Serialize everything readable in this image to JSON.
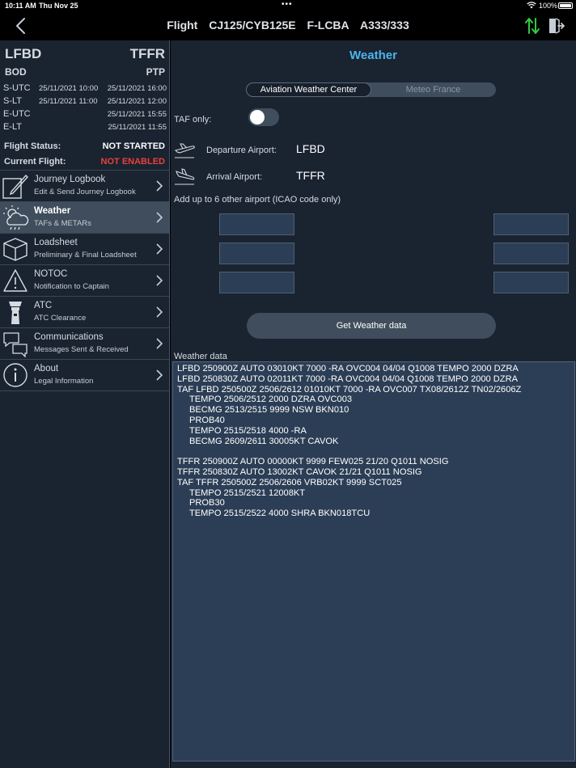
{
  "status_bar": {
    "time": "10:11 AM",
    "date": "Thu Nov 25",
    "battery": "100%"
  },
  "nav": {
    "flight_label": "Flight",
    "flight_number": "CJ125/CYB125E",
    "registration": "F-LCBA",
    "aircraft": "A333/333"
  },
  "flight": {
    "dep_icao": "LFBD",
    "arr_icao": "TFFR",
    "dep_iata": "BOD",
    "arr_iata": "PTP",
    "times": [
      {
        "label": "S-UTC",
        "dep": "25/11/2021 10:00",
        "arr": "25/11/2021 16:00"
      },
      {
        "label": "S-LT",
        "dep": "25/11/2021 11:00",
        "arr": "25/11/2021 12:00"
      },
      {
        "label": "E-UTC",
        "dep": "",
        "arr": "25/11/2021 15:55"
      },
      {
        "label": "E-LT",
        "dep": "",
        "arr": "25/11/2021 11:55"
      }
    ],
    "flight_status_label": "Flight Status:",
    "flight_status_value": "NOT STARTED",
    "current_flight_label": "Current Flight:",
    "current_flight_value": "NOT ENABLED",
    "colors": {
      "status": "#ffffff",
      "current": "#e8413a"
    }
  },
  "menu": {
    "items": [
      {
        "title": "Journey Logbook",
        "subtitle": "Edit & Send Journey Logbook",
        "icon": "journey-logbook-icon"
      },
      {
        "title": "Weather",
        "subtitle": "TAFs & METARs",
        "icon": "weather-cloud-icon"
      },
      {
        "title": "Loadsheet",
        "subtitle": "Preliminary & Final Loadsheet",
        "icon": "loadsheet-box-icon"
      },
      {
        "title": "NOTOC",
        "subtitle": "Notification to Captain",
        "icon": "warning-triangle-icon"
      },
      {
        "title": "ATC",
        "subtitle": "ATC Clearance",
        "icon": "control-tower-icon"
      },
      {
        "title": "Communications",
        "subtitle": "Messages Sent & Received",
        "icon": "chat-bubbles-icon"
      },
      {
        "title": "About",
        "subtitle": "Legal Information",
        "icon": "info-circle-icon"
      }
    ],
    "active_index": 1
  },
  "weather": {
    "title": "Weather",
    "sources": [
      "Aviation Weather Center",
      "Meteo France"
    ],
    "selected_source": "Aviation Weather Center",
    "taf_only_label": "TAF only:",
    "taf_only": false,
    "departure_label": "Departure Airport:",
    "departure_value": "LFBD",
    "arrival_label": "Arrival Airport:",
    "arrival_value": "TFFR",
    "add_label": "Add up to 6 other airport (ICAO code only)",
    "extra_airports": [
      "",
      "",
      "",
      "",
      "",
      ""
    ],
    "get_button": "Get Weather data",
    "data_label": "Weather data",
    "data_lines": [
      {
        "text": "LFBD 250900Z AUTO 03010KT 7000 -RA OVC004 04/04 Q1008 TEMPO 2000 DZRA",
        "indent": false
      },
      {
        "text": "LFBD 250830Z AUTO 02011KT 7000 -RA OVC004 04/04 Q1008 TEMPO 2000 DZRA",
        "indent": false
      },
      {
        "text": "TAF LFBD 250500Z 2506/2612 01010KT 7000 -RA OVC007 TX08/2612Z TN02/2606Z",
        "indent": false
      },
      {
        "text": "TEMPO 2506/2512 2000 DZRA OVC003",
        "indent": true
      },
      {
        "text": "BECMG 2513/2515 9999 NSW BKN010",
        "indent": true
      },
      {
        "text": "PROB40",
        "indent": true
      },
      {
        "text": "TEMPO 2515/2518 4000 -RA",
        "indent": true
      },
      {
        "text": "BECMG 2609/2611 30005KT CAVOK",
        "indent": true
      },
      {
        "text": "",
        "indent": false
      },
      {
        "text": "TFFR 250900Z AUTO 00000KT 9999 FEW025 21/20 Q1011 NOSIG",
        "indent": false
      },
      {
        "text": "TFFR 250830Z AUTO 13002KT CAVOK 21/21 Q1011 NOSIG",
        "indent": false
      },
      {
        "text": "TAF TFFR 250500Z 2506/2606 VRB02KT 9999 SCT025",
        "indent": false
      },
      {
        "text": "TEMPO 2515/2521 12008KT",
        "indent": true
      },
      {
        "text": "PROB30",
        "indent": true
      },
      {
        "text": "TEMPO 2515/2522 4000 SHRA BKN018TCU",
        "indent": true
      }
    ]
  },
  "theme": {
    "accent": "#4cb4ee",
    "panel": "#1a2330",
    "field": "#2c3e56",
    "sync_green": "#2ecc40"
  }
}
